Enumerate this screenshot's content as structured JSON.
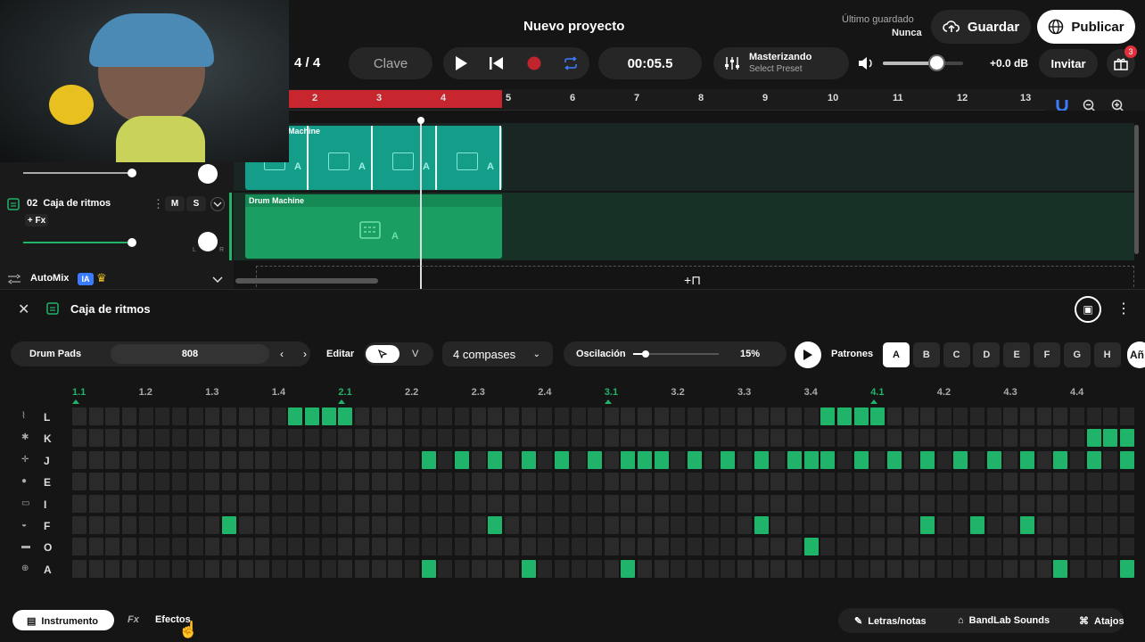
{
  "header": {
    "title": "Nuevo proyecto",
    "last_saved_label": "Último guardado",
    "last_saved_value": "Nunca",
    "save_label": "Guardar",
    "publish_label": "Publicar",
    "invite_label": "Invitar",
    "gift_badge": "3"
  },
  "transport": {
    "time_signature": "4 / 4",
    "key_label": "Clave",
    "time": "00:05.5",
    "mastering_title": "Masterizando",
    "mastering_preset": "Select Preset",
    "volume_db": "+0.0 dB",
    "volume_level": 0.8
  },
  "ruler": {
    "bars": [
      "2",
      "3",
      "4",
      "5",
      "6",
      "7",
      "8",
      "9",
      "10",
      "11",
      "12",
      "13"
    ]
  },
  "tracks": [
    {
      "clip_title": "Machine",
      "clip_letters": [
        "A",
        "A",
        "A",
        "A"
      ]
    },
    {
      "number": "02",
      "name": "Caja de ritmos",
      "mute": "M",
      "solo": "S",
      "fx": "+ Fx",
      "clip_title": "Drum Machine",
      "clip_letters": [
        "A"
      ]
    }
  ],
  "automix": {
    "label": "AutoMix",
    "ai_badge": "IA"
  },
  "editor": {
    "title": "Caja de ritmos",
    "kit_label": "Drum Pads",
    "kit_value": "808",
    "edit_label": "Editar",
    "edit_mode_v": "V",
    "bars_select": "4 compases",
    "swing_label": "Oscilación",
    "swing_value": "15%",
    "swing_level": 0.15,
    "patterns_label": "Patrones",
    "patterns": [
      "A",
      "B",
      "C",
      "D",
      "E",
      "F",
      "G",
      "H"
    ],
    "active_pattern": "A",
    "add_label": "Añ",
    "beats": [
      "1.1",
      "1.2",
      "1.3",
      "1.4",
      "2.1",
      "2.2",
      "2.3",
      "2.4",
      "3.1",
      "3.2",
      "3.3",
      "3.4",
      "4.1",
      "4.2",
      "4.3",
      "4.4"
    ],
    "rows": [
      {
        "key": "L",
        "steps": [
          13,
          14,
          15,
          16,
          45,
          46,
          47,
          48
        ]
      },
      {
        "key": "K",
        "steps": [
          61,
          62,
          63,
          64
        ]
      },
      {
        "key": "J",
        "steps": [
          21,
          23,
          25,
          27,
          29,
          31,
          33,
          34,
          35,
          37,
          39,
          41,
          43,
          44,
          45,
          47,
          49,
          51,
          53,
          55,
          57,
          59,
          61,
          63
        ]
      },
      {
        "key": "E",
        "steps": []
      },
      {
        "key": "I",
        "steps": []
      },
      {
        "key": "F",
        "steps": [
          9,
          25,
          41,
          51,
          54,
          57
        ]
      },
      {
        "key": "O",
        "steps": [
          44
        ]
      },
      {
        "key": "A",
        "steps": [
          21,
          27,
          33,
          59,
          63
        ]
      }
    ]
  },
  "bottom": {
    "instrument_label": "Instrumento",
    "effects_label": "Efectos",
    "fx_prefix": "Fx",
    "lyrics_label": "Letras/notas",
    "sounds_label": "BandLab Sounds",
    "shortcuts_label": "Atajos"
  }
}
